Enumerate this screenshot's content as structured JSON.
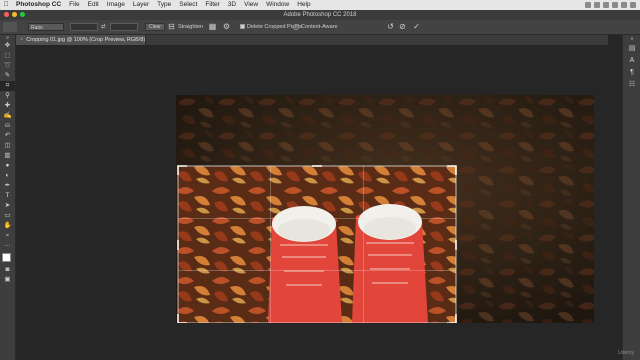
{
  "menubar": {
    "app": "Photoshop CC",
    "items": [
      "File",
      "Edit",
      "Image",
      "Layer",
      "Type",
      "Select",
      "Filter",
      "3D",
      "View",
      "Window",
      "Help"
    ]
  },
  "window": {
    "title": "Adobe Photoshop CC 2018"
  },
  "options": {
    "preset": "Ratio",
    "clear_label": "Clear",
    "straighten_label": "Straighten",
    "delete_cropped_label": "Delete Cropped Pixels",
    "delete_cropped_checked": true,
    "content_aware_label": "Content-Aware"
  },
  "document": {
    "tab_title": "Cropping 01.jpg @ 100% (Crop Preview, RGB/8) *"
  },
  "tools": [
    "move-tool-icon",
    "marquee-tool-icon",
    "lasso-tool-icon",
    "quick-select-tool-icon",
    "crop-tool-icon",
    "eyedropper-tool-icon",
    "healing-brush-tool-icon",
    "brush-tool-icon",
    "clone-stamp-tool-icon",
    "history-brush-tool-icon",
    "eraser-tool-icon",
    "gradient-tool-icon",
    "blur-tool-icon",
    "dodge-tool-icon",
    "pen-tool-icon",
    "type-tool-icon",
    "path-select-tool-icon",
    "rectangle-tool-icon",
    "hand-tool-icon",
    "zoom-tool-icon",
    "more-tools-icon"
  ],
  "watermark": "Udemy"
}
